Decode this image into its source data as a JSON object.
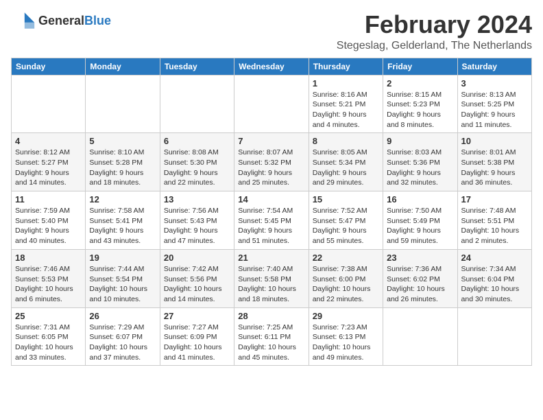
{
  "header": {
    "logo_general": "General",
    "logo_blue": "Blue",
    "month_title": "February 2024",
    "location": "Stegeslag, Gelderland, The Netherlands"
  },
  "weekdays": [
    "Sunday",
    "Monday",
    "Tuesday",
    "Wednesday",
    "Thursday",
    "Friday",
    "Saturday"
  ],
  "weeks": [
    [
      {
        "day": "",
        "info": ""
      },
      {
        "day": "",
        "info": ""
      },
      {
        "day": "",
        "info": ""
      },
      {
        "day": "",
        "info": ""
      },
      {
        "day": "1",
        "info": "Sunrise: 8:16 AM\nSunset: 5:21 PM\nDaylight: 9 hours\nand 4 minutes."
      },
      {
        "day": "2",
        "info": "Sunrise: 8:15 AM\nSunset: 5:23 PM\nDaylight: 9 hours\nand 8 minutes."
      },
      {
        "day": "3",
        "info": "Sunrise: 8:13 AM\nSunset: 5:25 PM\nDaylight: 9 hours\nand 11 minutes."
      }
    ],
    [
      {
        "day": "4",
        "info": "Sunrise: 8:12 AM\nSunset: 5:27 PM\nDaylight: 9 hours\nand 14 minutes."
      },
      {
        "day": "5",
        "info": "Sunrise: 8:10 AM\nSunset: 5:28 PM\nDaylight: 9 hours\nand 18 minutes."
      },
      {
        "day": "6",
        "info": "Sunrise: 8:08 AM\nSunset: 5:30 PM\nDaylight: 9 hours\nand 22 minutes."
      },
      {
        "day": "7",
        "info": "Sunrise: 8:07 AM\nSunset: 5:32 PM\nDaylight: 9 hours\nand 25 minutes."
      },
      {
        "day": "8",
        "info": "Sunrise: 8:05 AM\nSunset: 5:34 PM\nDaylight: 9 hours\nand 29 minutes."
      },
      {
        "day": "9",
        "info": "Sunrise: 8:03 AM\nSunset: 5:36 PM\nDaylight: 9 hours\nand 32 minutes."
      },
      {
        "day": "10",
        "info": "Sunrise: 8:01 AM\nSunset: 5:38 PM\nDaylight: 9 hours\nand 36 minutes."
      }
    ],
    [
      {
        "day": "11",
        "info": "Sunrise: 7:59 AM\nSunset: 5:40 PM\nDaylight: 9 hours\nand 40 minutes."
      },
      {
        "day": "12",
        "info": "Sunrise: 7:58 AM\nSunset: 5:41 PM\nDaylight: 9 hours\nand 43 minutes."
      },
      {
        "day": "13",
        "info": "Sunrise: 7:56 AM\nSunset: 5:43 PM\nDaylight: 9 hours\nand 47 minutes."
      },
      {
        "day": "14",
        "info": "Sunrise: 7:54 AM\nSunset: 5:45 PM\nDaylight: 9 hours\nand 51 minutes."
      },
      {
        "day": "15",
        "info": "Sunrise: 7:52 AM\nSunset: 5:47 PM\nDaylight: 9 hours\nand 55 minutes."
      },
      {
        "day": "16",
        "info": "Sunrise: 7:50 AM\nSunset: 5:49 PM\nDaylight: 9 hours\nand 59 minutes."
      },
      {
        "day": "17",
        "info": "Sunrise: 7:48 AM\nSunset: 5:51 PM\nDaylight: 10 hours\nand 2 minutes."
      }
    ],
    [
      {
        "day": "18",
        "info": "Sunrise: 7:46 AM\nSunset: 5:53 PM\nDaylight: 10 hours\nand 6 minutes."
      },
      {
        "day": "19",
        "info": "Sunrise: 7:44 AM\nSunset: 5:54 PM\nDaylight: 10 hours\nand 10 minutes."
      },
      {
        "day": "20",
        "info": "Sunrise: 7:42 AM\nSunset: 5:56 PM\nDaylight: 10 hours\nand 14 minutes."
      },
      {
        "day": "21",
        "info": "Sunrise: 7:40 AM\nSunset: 5:58 PM\nDaylight: 10 hours\nand 18 minutes."
      },
      {
        "day": "22",
        "info": "Sunrise: 7:38 AM\nSunset: 6:00 PM\nDaylight: 10 hours\nand 22 minutes."
      },
      {
        "day": "23",
        "info": "Sunrise: 7:36 AM\nSunset: 6:02 PM\nDaylight: 10 hours\nand 26 minutes."
      },
      {
        "day": "24",
        "info": "Sunrise: 7:34 AM\nSunset: 6:04 PM\nDaylight: 10 hours\nand 30 minutes."
      }
    ],
    [
      {
        "day": "25",
        "info": "Sunrise: 7:31 AM\nSunset: 6:05 PM\nDaylight: 10 hours\nand 33 minutes."
      },
      {
        "day": "26",
        "info": "Sunrise: 7:29 AM\nSunset: 6:07 PM\nDaylight: 10 hours\nand 37 minutes."
      },
      {
        "day": "27",
        "info": "Sunrise: 7:27 AM\nSunset: 6:09 PM\nDaylight: 10 hours\nand 41 minutes."
      },
      {
        "day": "28",
        "info": "Sunrise: 7:25 AM\nSunset: 6:11 PM\nDaylight: 10 hours\nand 45 minutes."
      },
      {
        "day": "29",
        "info": "Sunrise: 7:23 AM\nSunset: 6:13 PM\nDaylight: 10 hours\nand 49 minutes."
      },
      {
        "day": "",
        "info": ""
      },
      {
        "day": "",
        "info": ""
      }
    ]
  ]
}
